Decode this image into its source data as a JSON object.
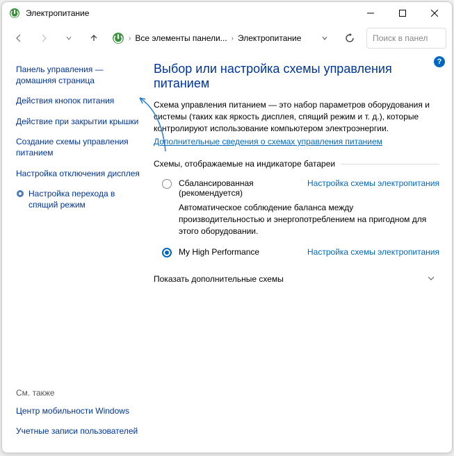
{
  "titlebar": {
    "title": "Электропитание"
  },
  "nav": {
    "breadcrumb": {
      "part1": "Все элементы панели...",
      "part2": "Электропитание"
    },
    "search_placeholder": "Поиск в панел"
  },
  "sidebar": {
    "home": "Панель управления — домашняя страница",
    "links": [
      "Действия кнопок питания",
      "Действие при закрытии крышки",
      "Создание схемы управления питанием",
      "Настройка отключения дисплея"
    ],
    "sleep": "Настройка перехода в спящий режим",
    "see_also_label": "См. также",
    "see_also": [
      "Центр мобильности Windows",
      "Учетные записи пользователей"
    ]
  },
  "main": {
    "heading": "Выбор или настройка схемы управления питанием",
    "description": "Схема управления питанием — это набор параметров оборудования и системы (таких как яркость дисплея, спящий режим и т. д.), которые контролируют использование компьютером электроэнергии.",
    "learn_more": "Дополнительные сведения о схемах управления питанием",
    "group_label": "Схемы, отображаемые на индикаторе батареи",
    "plans": [
      {
        "name": "Сбалансированная (рекомендуется)",
        "settings": "Настройка схемы электропитания",
        "desc": "Автоматическое соблюдение баланса между производительностью и энергопотреблением на пригодном для этого оборудовании.",
        "selected": false
      },
      {
        "name": "My High Performance",
        "settings": "Настройка схемы электропитания",
        "desc": "",
        "selected": true
      }
    ],
    "expand": "Показать дополнительные схемы"
  }
}
